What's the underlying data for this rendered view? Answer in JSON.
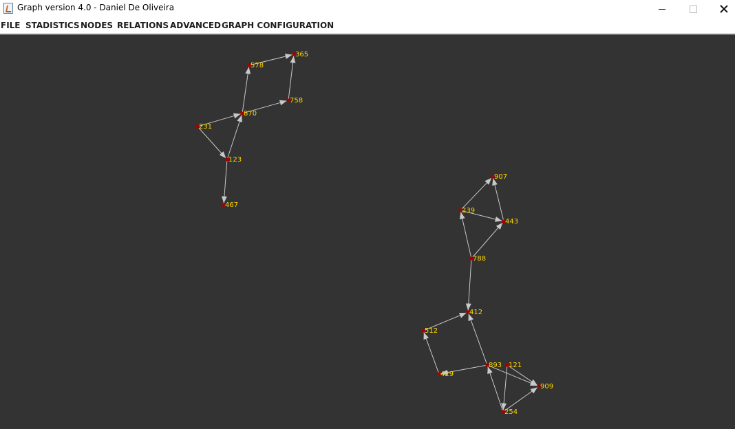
{
  "window": {
    "title": "Graph version 4.0 - Daniel De Oliveira",
    "app_icon": "java-cup-icon"
  },
  "menu": {
    "items": [
      "FILE",
      "STADISTICS",
      "NODES",
      "RELATIONS",
      "ADVANCED",
      "GRAPH CONFIGURATION"
    ]
  },
  "colors": {
    "canvas_background": "#333333",
    "edge": "#c8c8c8",
    "node": "#a80000",
    "label": "#ffd700"
  },
  "graph": {
    "nodes": [
      {
        "id": "365"
      },
      {
        "id": "578"
      },
      {
        "id": "758"
      },
      {
        "id": "870"
      },
      {
        "id": "231"
      },
      {
        "id": "123"
      },
      {
        "id": "467"
      },
      {
        "id": "907"
      },
      {
        "id": "239"
      },
      {
        "id": "443"
      },
      {
        "id": "788"
      },
      {
        "id": "412"
      },
      {
        "id": "512"
      },
      {
        "id": "893"
      },
      {
        "id": "121"
      },
      {
        "id": "429"
      },
      {
        "id": "909"
      },
      {
        "id": "254"
      }
    ],
    "edges": [
      {
        "from": "578",
        "to": "365"
      },
      {
        "from": "758",
        "to": "365"
      },
      {
        "from": "870",
        "to": "578"
      },
      {
        "from": "870",
        "to": "758"
      },
      {
        "from": "231",
        "to": "870"
      },
      {
        "from": "231",
        "to": "123"
      },
      {
        "from": "123",
        "to": "870"
      },
      {
        "from": "123",
        "to": "467"
      },
      {
        "from": "239",
        "to": "907"
      },
      {
        "from": "443",
        "to": "907"
      },
      {
        "from": "239",
        "to": "443"
      },
      {
        "from": "788",
        "to": "239"
      },
      {
        "from": "788",
        "to": "443"
      },
      {
        "from": "788",
        "to": "412"
      },
      {
        "from": "512",
        "to": "412"
      },
      {
        "from": "893",
        "to": "412"
      },
      {
        "from": "429",
        "to": "512"
      },
      {
        "from": "893",
        "to": "429"
      },
      {
        "from": "893",
        "to": "909"
      },
      {
        "from": "121",
        "to": "909"
      },
      {
        "from": "254",
        "to": "909"
      },
      {
        "from": "254",
        "to": "893"
      },
      {
        "from": "121",
        "to": "254"
      }
    ]
  }
}
